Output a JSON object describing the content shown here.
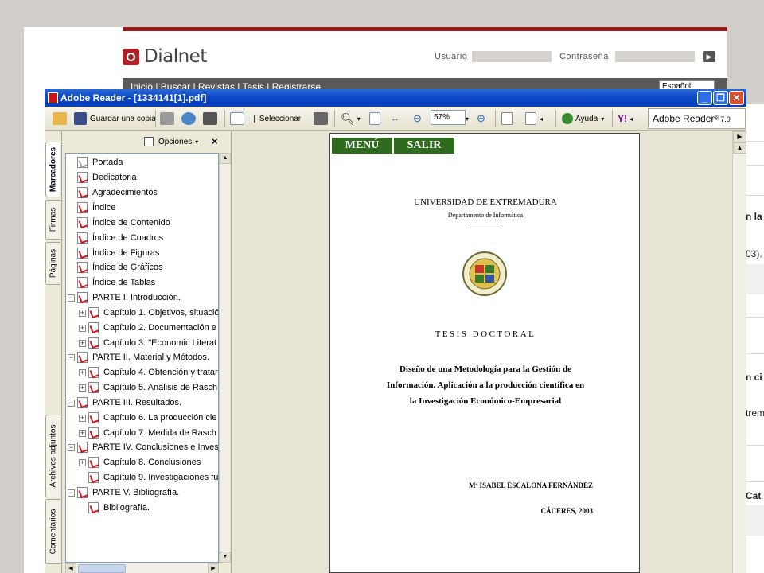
{
  "background_site": {
    "logo_text": "Dialnet",
    "usuario_label": "Usuario",
    "password_label": "Contraseña",
    "nav": "Inicio | Buscar | Revistas | Tesis | Registrarse",
    "language": "Español",
    "right_edge_text": [
      "n la",
      "03).",
      "n ci",
      "trem",
      "Cat"
    ]
  },
  "reader": {
    "title": "Adobe Reader - [1334141[1].pdf]",
    "toolbar": {
      "save_copy_label": "Guardar una copia",
      "select_label": "Seleccionar",
      "zoom_value": "57%",
      "help_label": "Ayuda",
      "yahoo_label": "Y!",
      "adobe_badge": "Adobe Reader",
      "adobe_version": "7.0"
    },
    "side_tabs": [
      "Marcadores",
      "Firmas",
      "Páginas",
      "Archivos adjuntos",
      "Comentarios"
    ],
    "bookmarks": {
      "options_label": "Opciones",
      "close_label": "×",
      "items": [
        {
          "label": "Portada"
        },
        {
          "label": "Dedicatoria"
        },
        {
          "label": "Agradecimientos"
        },
        {
          "label": "Índice"
        },
        {
          "label": "Índice de Contenido"
        },
        {
          "label": "Índice de Cuadros"
        },
        {
          "label": "Índice de Figuras"
        },
        {
          "label": "Índice de Gráficos"
        },
        {
          "label": "Índice de Tablas"
        },
        {
          "label": "PARTE I. Introducción."
        },
        {
          "label": "Capítulo 1. Objetivos, situació"
        },
        {
          "label": "Capítulo 2. Documentación e"
        },
        {
          "label": "Capítulo 3. \"Economic Literat"
        },
        {
          "label": "PARTE II. Material y Métodos."
        },
        {
          "label": "Capítulo 4. Obtención y tratar"
        },
        {
          "label": "Capítulo 5. Análisis de Rasch"
        },
        {
          "label": "PARTE III. Resultados."
        },
        {
          "label": "Capítulo 6. La producción cie"
        },
        {
          "label": "Capítulo 7. Medida de Rasch"
        },
        {
          "label": "PARTE IV. Conclusiones e Inves"
        },
        {
          "label": "Capítulo 8. Conclusiones"
        },
        {
          "label": "Capítulo 9. Investigaciones fu"
        },
        {
          "label": "PARTE V. Bibliografía."
        },
        {
          "label": "Bibliografía."
        }
      ]
    },
    "document": {
      "menu_button": "MENÚ",
      "exit_button": "SALIR",
      "university": "UNIVERSIDAD DE EXTREMADURA",
      "department": "Departamento de Informática",
      "thesis_label": "TESIS DOCTORAL",
      "title_line1": "Diseño de una Metodología para la Gestión de",
      "title_line2": "Información. Aplicación a la producción científica en",
      "title_line3": "la Investigación Económico-Empresarial",
      "author": "Mª ISABEL ESCALONA FERNÁNDEZ",
      "place_year": "CÁCERES, 2003"
    }
  },
  "colors": {
    "dialnet_red": "#b01f24",
    "xp_titlebar": "#0b47c9",
    "pdf_button_green": "#2e6b1d"
  }
}
